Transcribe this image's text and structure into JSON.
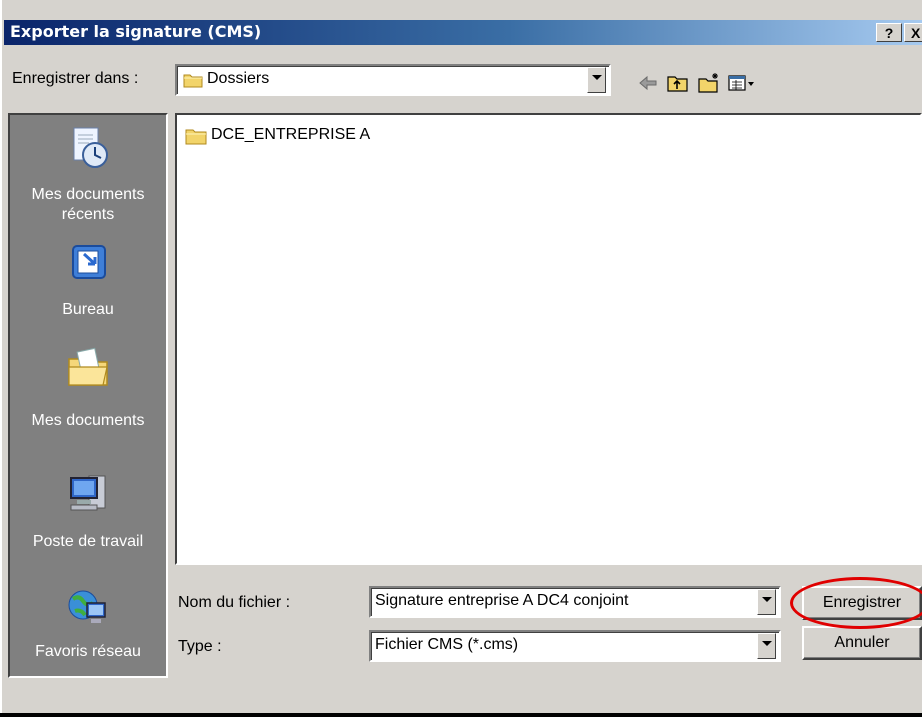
{
  "window": {
    "title": "Exporter la signature (CMS)",
    "help_label": "?",
    "close_label": "X"
  },
  "toolbar": {
    "save_in_label": "Enregistrer dans :",
    "location_value": "Dossiers",
    "icons": [
      "back-arrow-icon",
      "up-folder-icon",
      "new-folder-icon",
      "view-menu-icon"
    ]
  },
  "places": [
    {
      "label": "Mes documents récents",
      "icon": "recent-documents-icon"
    },
    {
      "label": "Bureau",
      "icon": "desktop-icon"
    },
    {
      "label": "Mes documents",
      "icon": "my-documents-icon"
    },
    {
      "label": "Poste de travail",
      "icon": "my-computer-icon"
    },
    {
      "label": "Favoris réseau",
      "icon": "network-places-icon"
    }
  ],
  "files": [
    {
      "name": "DCE_ENTREPRISE A",
      "icon": "folder-icon"
    }
  ],
  "form": {
    "filename_label": "Nom du fichier :",
    "filename_value": "Signature entreprise A DC4 conjoint",
    "type_label": "Type :",
    "type_value": "Fichier CMS (*.cms)"
  },
  "buttons": {
    "save_label": "Enregistrer",
    "cancel_label": "Annuler"
  },
  "colors": {
    "title_gradient_start": "#0a246a",
    "title_gradient_end": "#a6caf0",
    "dialog_background": "#d6d3ce",
    "places_background": "#808080",
    "highlight": "#e00000"
  }
}
